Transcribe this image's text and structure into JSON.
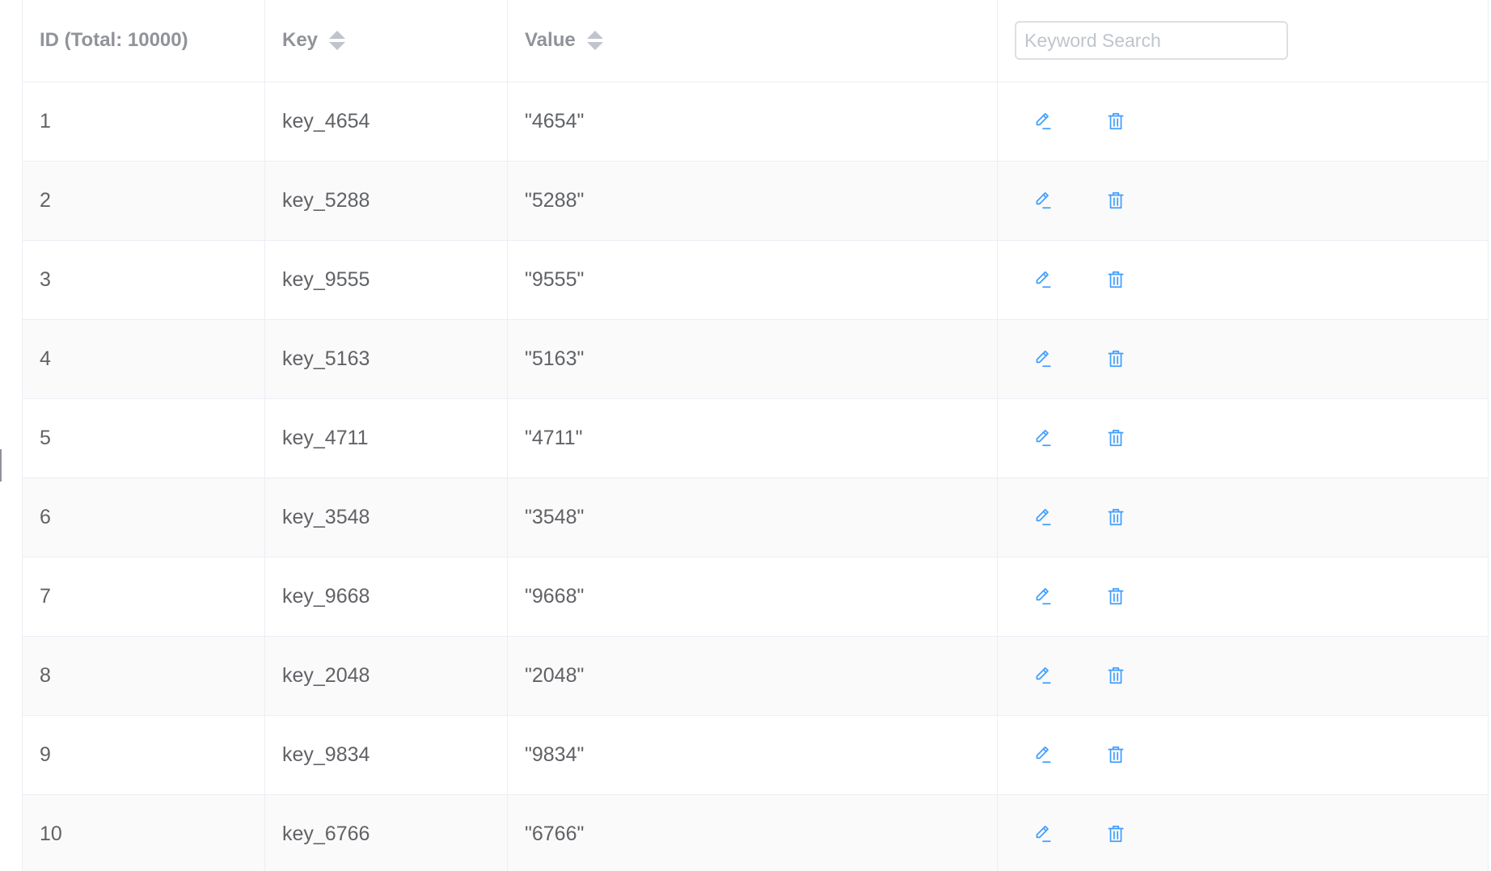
{
  "table": {
    "headers": {
      "id": "ID (Total: 10000)",
      "key": "Key",
      "value": "Value"
    },
    "search": {
      "placeholder": "Keyword Search",
      "value": ""
    },
    "rows": [
      {
        "id": "1",
        "key": "key_4654",
        "value": "\"4654\""
      },
      {
        "id": "2",
        "key": "key_5288",
        "value": "\"5288\""
      },
      {
        "id": "3",
        "key": "key_9555",
        "value": "\"9555\""
      },
      {
        "id": "4",
        "key": "key_5163",
        "value": "\"5163\""
      },
      {
        "id": "5",
        "key": "key_4711",
        "value": "\"4711\""
      },
      {
        "id": "6",
        "key": "key_3548",
        "value": "\"3548\""
      },
      {
        "id": "7",
        "key": "key_9668",
        "value": "\"9668\""
      },
      {
        "id": "8",
        "key": "key_2048",
        "value": "\"2048\""
      },
      {
        "id": "9",
        "key": "key_9834",
        "value": "\"9834\""
      },
      {
        "id": "10",
        "key": "key_6766",
        "value": "\"6766\""
      }
    ],
    "row_actions": [
      "edit-icon",
      "delete-icon"
    ]
  },
  "colors": {
    "header_text": "#909399",
    "cell_text": "#606266",
    "border": "#ebeef5",
    "stripe": "#fafafa",
    "icon_accent": "#409eff",
    "sort_caret": "#c0c4cc"
  }
}
